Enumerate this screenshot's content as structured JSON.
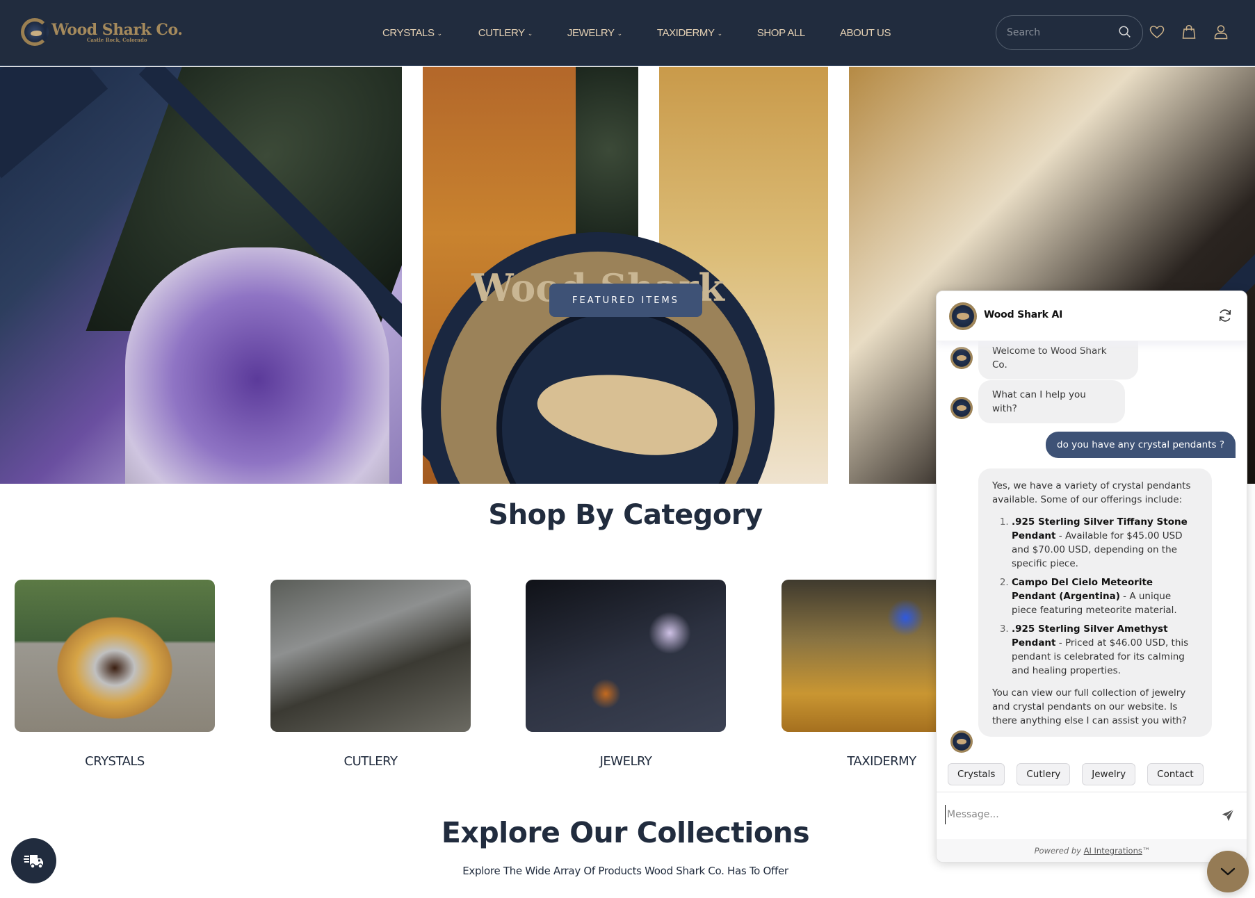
{
  "header": {
    "logo_title": "Wood Shark Co.",
    "logo_subtitle": "Castle Rock, Colorado",
    "nav": [
      {
        "label": "CRYSTALS",
        "has_dropdown": true
      },
      {
        "label": "CUTLERY",
        "has_dropdown": true
      },
      {
        "label": "JEWELRY",
        "has_dropdown": true
      },
      {
        "label": "TAXIDERMY",
        "has_dropdown": true
      },
      {
        "label": "SHOP ALL",
        "has_dropdown": false
      },
      {
        "label": "ABOUT US",
        "has_dropdown": false
      }
    ],
    "dropdown_glyph": "⌄",
    "search": {
      "placeholder": "Search",
      "value": ""
    },
    "icons": [
      "search-icon",
      "heart-icon",
      "shopping-bag-icon",
      "user-icon"
    ]
  },
  "hero": {
    "emblem_text": "Wood Shark Co.",
    "featured_button": "FEATURED ITEMS"
  },
  "shop_by_category": {
    "title": "Shop By Category",
    "categories": [
      {
        "label": "CRYSTALS"
      },
      {
        "label": "CUTLERY"
      },
      {
        "label": "JEWELRY"
      },
      {
        "label": "TAXIDERMY"
      }
    ]
  },
  "explore": {
    "title": "Explore Our Collections",
    "subtitle": "Explore The Wide Array Of Products Wood Shark Co. Has To Offer"
  },
  "chat": {
    "title": "Wood Shark AI",
    "messages": [
      {
        "role": "bot",
        "text": "Welcome to Wood Shark Co."
      },
      {
        "role": "bot",
        "text": "What can I help you with?"
      },
      {
        "role": "user",
        "text": "do you have any crystal pendants ?"
      },
      {
        "role": "bot",
        "intro": "Yes, we have a variety of crystal pendants available. Some of our offerings include:",
        "items": [
          {
            "name": ".925 Sterling Silver Tiffany Stone Pendant",
            "desc": " - Available for $45.00 USD and $70.00 USD, depending on the specific piece."
          },
          {
            "name": "Campo Del Cielo Meteorite Pendant (Argentina)",
            "desc": " - A unique piece featuring meteorite material."
          },
          {
            "name": ".925 Sterling Silver Amethyst Pendant",
            "desc": " - Priced at $46.00 USD, this pendant is celebrated for its calming and healing properties."
          }
        ],
        "outro": "You can view our full collection of jewelry and crystal pendants on our website. Is there anything else I can assist you with?"
      }
    ],
    "quick_replies": [
      "Crystals",
      "Cutlery",
      "Jewelry",
      "Contact"
    ],
    "input": {
      "placeholder": "Message...",
      "value": ""
    },
    "footer_prefix": "Powered by ",
    "footer_link": "AI Integrations",
    "footer_suffix": "™"
  },
  "colors": {
    "navy": "#212c3e",
    "gold": "#957b55",
    "nav_text": "#e6d2b5",
    "user_bubble": "#3e5276",
    "bot_bubble": "#f0f0f1"
  }
}
